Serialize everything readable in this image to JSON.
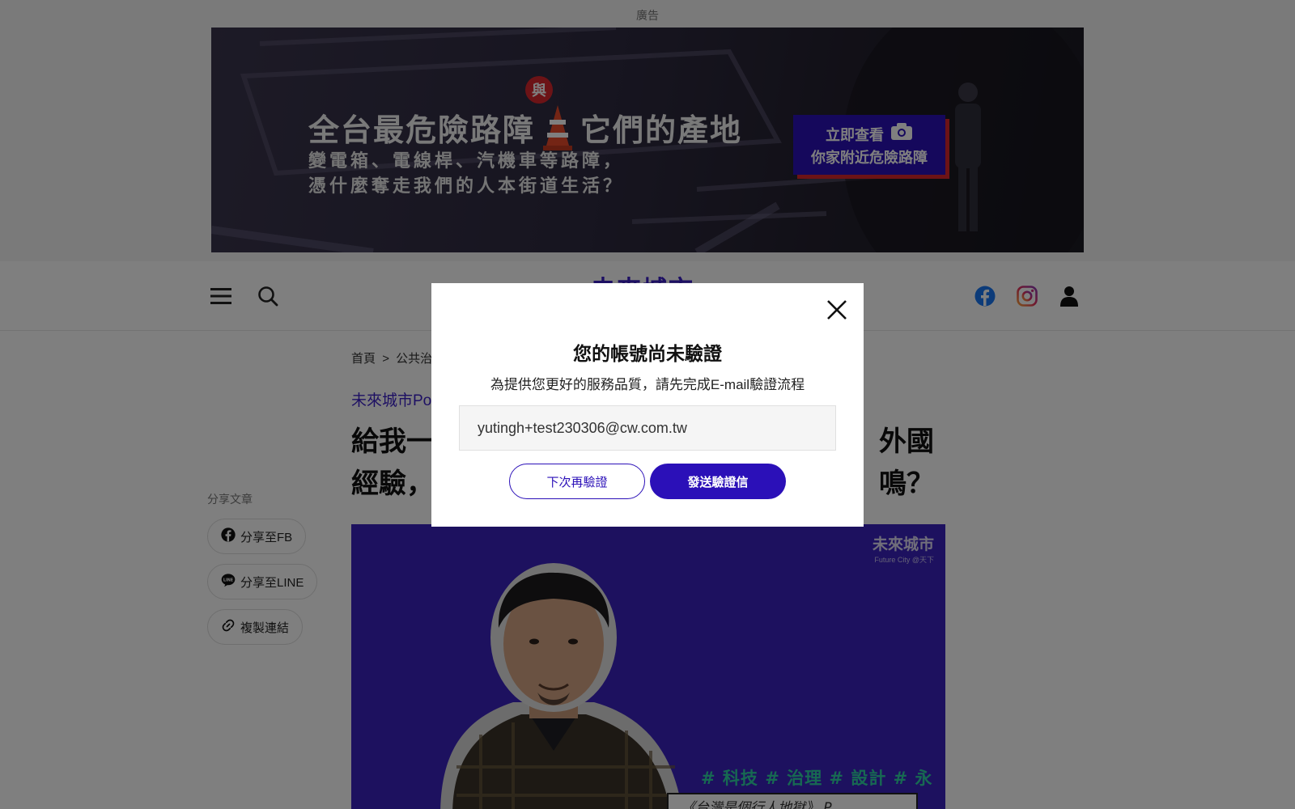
{
  "ad": {
    "label": "廣告",
    "headline_part1": "全台最危險路障",
    "headline_part2": "它們的產地",
    "badge": "與",
    "sub_line1": "變電箱、電線桿、汽機車等路障，",
    "sub_line2": "憑什麼奪走我們的人本街道生活？",
    "cta_line1": "立即查看",
    "cta_line2": "你家附近危險路障"
  },
  "header": {
    "logo": "未來城市",
    "menu_icon": "hamburger-icon",
    "search_icon": "search-icon",
    "facebook_icon": "facebook-icon",
    "instagram_icon": "instagram-icon",
    "user_icon": "user-icon"
  },
  "article": {
    "breadcrumb_home": "首頁",
    "breadcrumb_sep": ">",
    "breadcrumb_section": "公共治理",
    "category": "未來城市Po",
    "headline_line1_left": "給我一",
    "headline_line1_right": "外國",
    "headline_line2_left": "經驗，",
    "headline_line2_right": "鳴？"
  },
  "share": {
    "label": "分享文章",
    "fb": "分享至FB",
    "line": "分享至LINE",
    "copy": "複製連結"
  },
  "hero": {
    "logo_main": "未來城市",
    "logo_sub": "Future City @天下",
    "tags": "# 科技 # 治理 # 設計 # 永續",
    "caption": "《台灣是個行人地獄》 P"
  },
  "modal": {
    "title": "您的帳號尚未驗證",
    "description": "為提供您更好的服務品質，請先完成E-mail驗證流程",
    "email_value": "yutingh+test230306@cw.com.tw",
    "later_label": "下次再驗證",
    "send_label": "發送驗證信"
  },
  "colors": {
    "brand": "#2b10b8",
    "accent_red": "#d8262c",
    "tag_green": "#2fd3a4"
  }
}
